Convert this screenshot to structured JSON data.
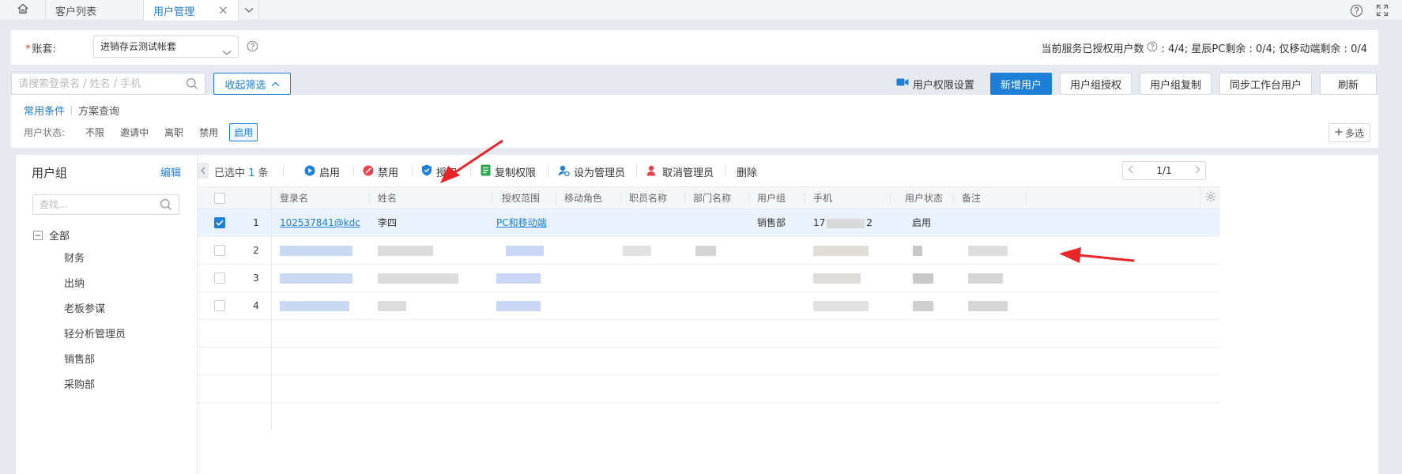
{
  "tabs": {
    "home_icon": "home-icon",
    "items": [
      {
        "label": "客户列表"
      },
      {
        "label": "用户管理"
      }
    ],
    "close_glyph": "×"
  },
  "account": {
    "label": "账套:",
    "required_mark": "*",
    "selected": "进销存云测试帐套",
    "license_text": "当前服务已授权用户数",
    "license_counts": ": 4/4;  星辰PC剩余 : 0/4;  仅移动端剩余 : 0/4"
  },
  "search": {
    "placeholder": "请搜索登录名 / 姓名 / 手机"
  },
  "toolbar": {
    "collapse_label": "收起筛选",
    "permission_settings": "用户权限设置",
    "add_user": "新增用户",
    "group_authorize": "用户组授权",
    "group_copy": "用户组复制",
    "sync_users": "同步工作台用户",
    "refresh": "刷新"
  },
  "filters": {
    "tab_common": "常用条件",
    "tab_scheme": "方案查询",
    "status_label": "用户状态:",
    "status_options": [
      "不限",
      "邀请中",
      "离职",
      "禁用",
      "启用"
    ],
    "active_status": "启用",
    "multi_select": "多选"
  },
  "groups": {
    "title": "用户组",
    "edit": "编辑",
    "search_placeholder": "查找...",
    "root": "全部",
    "items": [
      "财务",
      "出纳",
      "老板参谋",
      "轻分析管理员",
      "销售部",
      "采购部"
    ]
  },
  "grid_actions": {
    "selected_prefix": "已选中",
    "selected_count": "1",
    "selected_suffix": "条",
    "enable": "启用",
    "disable": "禁用",
    "authorize": "授权",
    "copy_permission": "复制权限",
    "set_admin": "设为管理员",
    "cancel_admin": "取消管理员",
    "delete": "删除",
    "page": "1/1"
  },
  "columns": [
    "登录名",
    "姓名",
    "授权范围",
    "移动角色",
    "职员名称",
    "部门名称",
    "用户组",
    "手机",
    "用户状态",
    "备注"
  ],
  "rows": [
    {
      "num": "1",
      "login": "102537841@kdc",
      "name": "李四",
      "scope": "PC和移动端",
      "group": "销售部",
      "phone_prefix": "17",
      "phone_suffix": "2",
      "status": "启用",
      "checked": true
    },
    {
      "num": "2",
      "checked": false
    },
    {
      "num": "3",
      "checked": false
    },
    {
      "num": "4",
      "checked": false
    }
  ],
  "colors": {
    "accent": "#1e7fd6",
    "annotation_arrow": "#e8262a",
    "disable_icon": "#e8414a",
    "enable_icon": "#1e7fd6"
  }
}
